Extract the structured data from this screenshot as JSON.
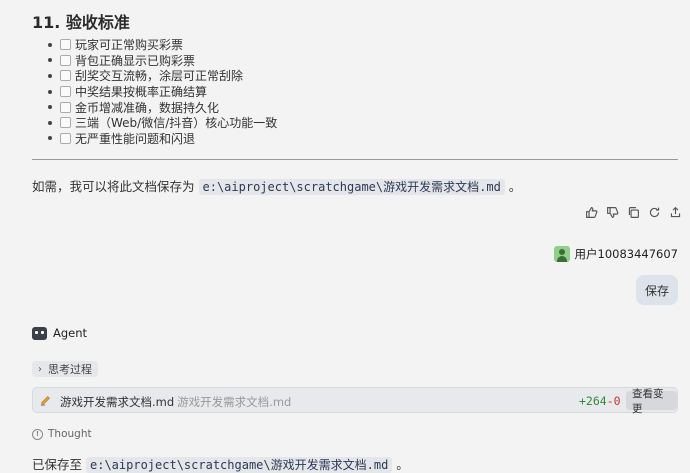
{
  "section": {
    "title": "11. 验收标准",
    "items": [
      "玩家可正常购买彩票",
      "背包正确显示已购彩票",
      "刮奖交互流畅，涂层可正常刮除",
      "中奖结果按概率正确结算",
      "金币增减准确，数据持久化",
      "三端（Web/微信/抖音）核心功能一致",
      "无严重性能问题和闪退"
    ]
  },
  "save_hint": {
    "prefix": "如需，我可以将此文档保存为",
    "path": "e:\\aiproject\\scratchgame\\游戏开发需求文档.md",
    "suffix": "。"
  },
  "feedback_icons": [
    "thumbs-up-icon",
    "thumbs-down-icon",
    "copy-icon",
    "refresh-icon",
    "share-icon"
  ],
  "user": {
    "name": "用户10083447607",
    "message": "保存"
  },
  "agent": {
    "name": "Agent",
    "thinking_label": "思考过程",
    "file_card": {
      "name": "游戏开发需求文档.md",
      "path": "游戏开发需求文档.md",
      "added": "+264",
      "removed": "-0",
      "view_label": "查看变更"
    },
    "thought_label": "Thought",
    "saved": {
      "prefix": "已保存至",
      "path": "e:\\aiproject\\scratchgame\\游戏开发需求文档.md",
      "suffix": "。"
    }
  },
  "colors": {
    "background": "#f3f3f3",
    "added": "#2e8b3a",
    "removed": "#c0392b"
  }
}
